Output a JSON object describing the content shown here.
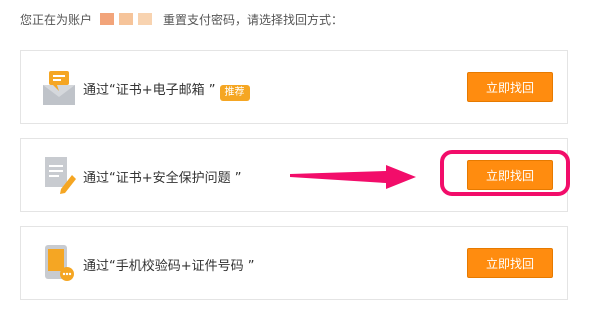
{
  "header": {
    "prefix": "您正在为账户",
    "suffix": "重置支付密码，请选择找回方式："
  },
  "colors": {
    "mask": [
      "#f2a47a",
      "#f6c49a",
      "#f8d3b0"
    ],
    "button": "#ff8c0f",
    "highlight": "#f20d6a",
    "badge": "#f5a623"
  },
  "options": [
    {
      "icon": "mail-icon",
      "text": "通过“证书+电子邮箱 ”",
      "badge": "推荐",
      "button": "立即找回"
    },
    {
      "icon": "document-edit-icon",
      "text": "通过“证书+安全保护问题 ”",
      "button": "立即找回"
    },
    {
      "icon": "mobile-phone-icon",
      "text": "通过“手机校验码+证件号码 ”",
      "button": "立即找回"
    }
  ]
}
